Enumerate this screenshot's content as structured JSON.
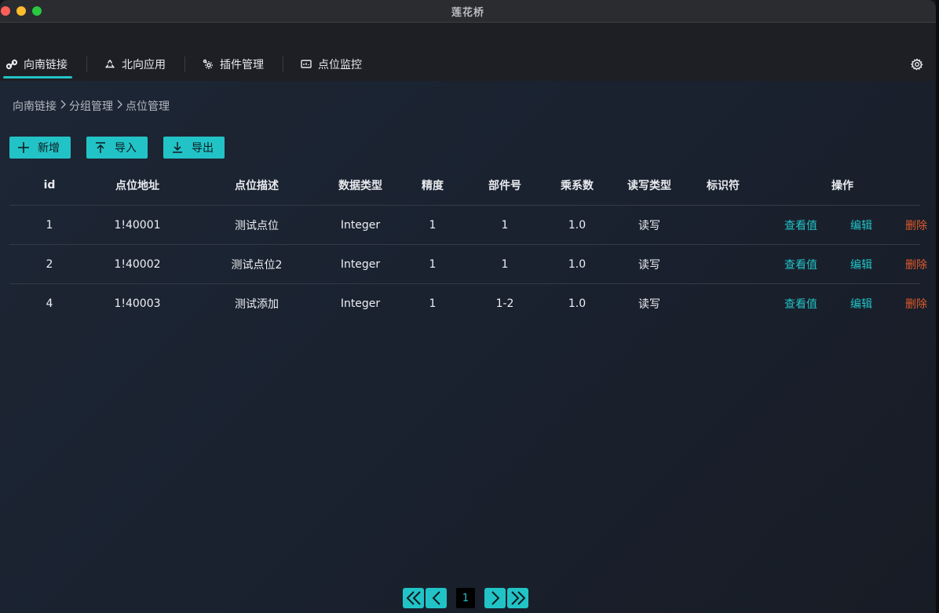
{
  "app": {
    "title": "莲花桥"
  },
  "tabs": [
    {
      "label": "向南链接",
      "icon": "link-icon",
      "active": true
    },
    {
      "label": "北向应用",
      "icon": "recycle-icon"
    },
    {
      "label": "插件管理",
      "icon": "plugin-gear-icon"
    },
    {
      "label": "点位监控",
      "icon": "monitor-icon"
    }
  ],
  "breadcrumb": [
    "向南链接",
    "分组管理",
    "点位管理"
  ],
  "toolbar": {
    "add_label": "新增",
    "import_label": "导入",
    "export_label": "导出"
  },
  "table": {
    "columns": [
      "id",
      "点位地址",
      "点位描述",
      "数据类型",
      "精度",
      "部件号",
      "乘系数",
      "读写类型",
      "标识符",
      "操作"
    ],
    "rows": [
      {
        "id": "1",
        "address": "1!40001",
        "desc": "测试点位",
        "type": "Integer",
        "precision": "1",
        "part": "1",
        "mult": "1.0",
        "rw": "读写",
        "ident": ""
      },
      {
        "id": "2",
        "address": "1!40002",
        "desc": "测试点位2",
        "type": "Integer",
        "precision": "1",
        "part": "1",
        "mult": "1.0",
        "rw": "读写",
        "ident": ""
      },
      {
        "id": "4",
        "address": "1!40003",
        "desc": "测试添加",
        "type": "Integer",
        "precision": "1",
        "part": "1-2",
        "mult": "1.0",
        "rw": "读写",
        "ident": ""
      }
    ],
    "actions": {
      "view": "查看值",
      "edit": "编辑",
      "delete": "删除"
    }
  },
  "pagination": {
    "current_page": "1"
  },
  "colors": {
    "accent": "#22c3c6",
    "danger": "#e05a2b"
  }
}
